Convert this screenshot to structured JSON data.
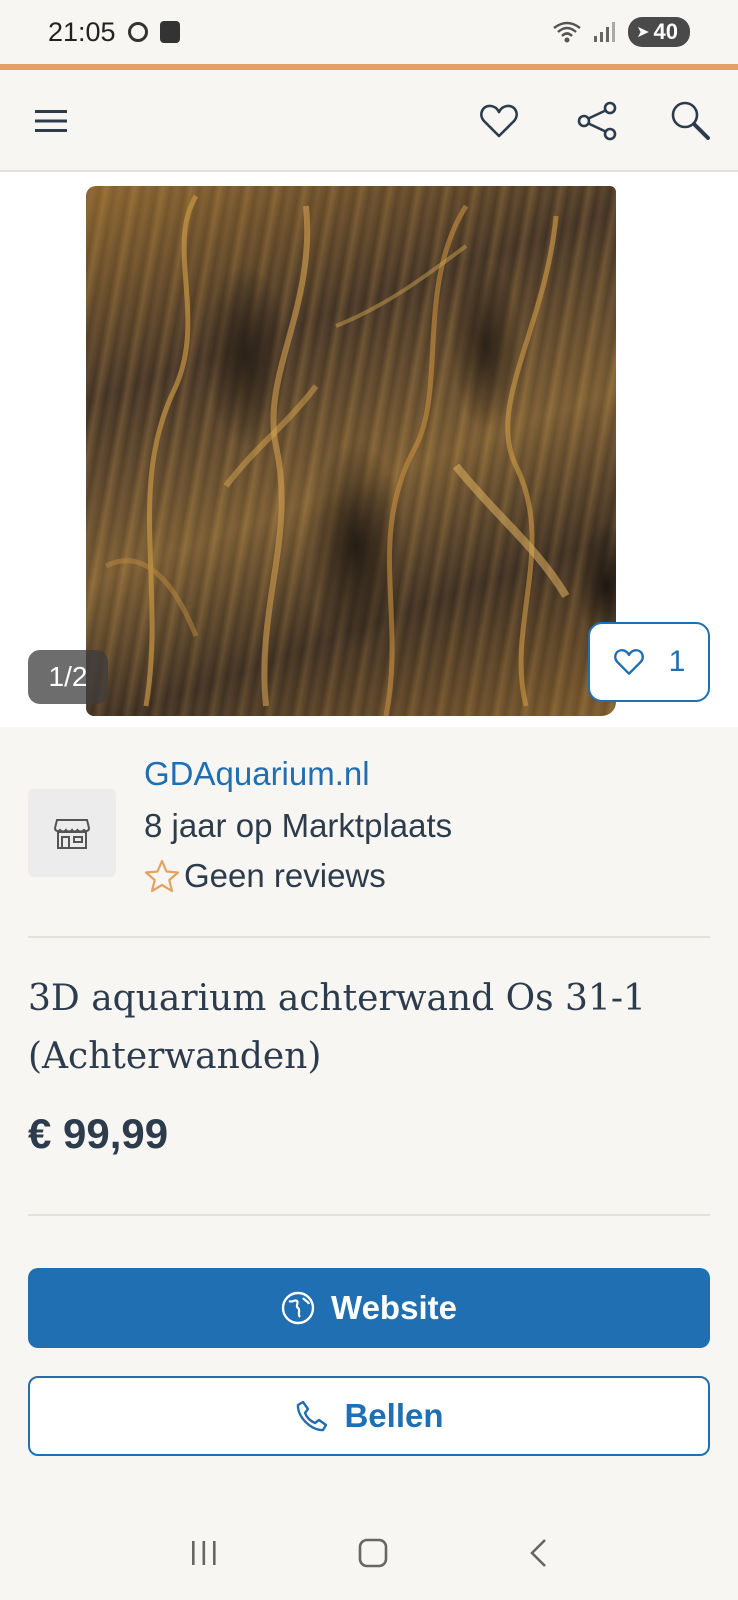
{
  "status_bar": {
    "time": "21:05",
    "battery": "40"
  },
  "appbar": {
    "icons": [
      "menu-icon",
      "heart-icon",
      "share-icon",
      "search-icon"
    ]
  },
  "gallery": {
    "counter": "1/2",
    "favorites_count": "1"
  },
  "seller": {
    "name": "GDAquarium.nl",
    "years": "8 jaar op Marktplaats",
    "reviews": "Geen reviews"
  },
  "listing": {
    "title": "3D aquarium achterwand Os 31-1 (Achterwanden)",
    "price": "€ 99,99"
  },
  "actions": {
    "website_label": "Website",
    "call_label": "Bellen"
  },
  "colors": {
    "accent": "#1f6fb2",
    "top_accent_line": "#e2a262",
    "text": "#2d3c4d",
    "background": "#f7f6f2"
  }
}
